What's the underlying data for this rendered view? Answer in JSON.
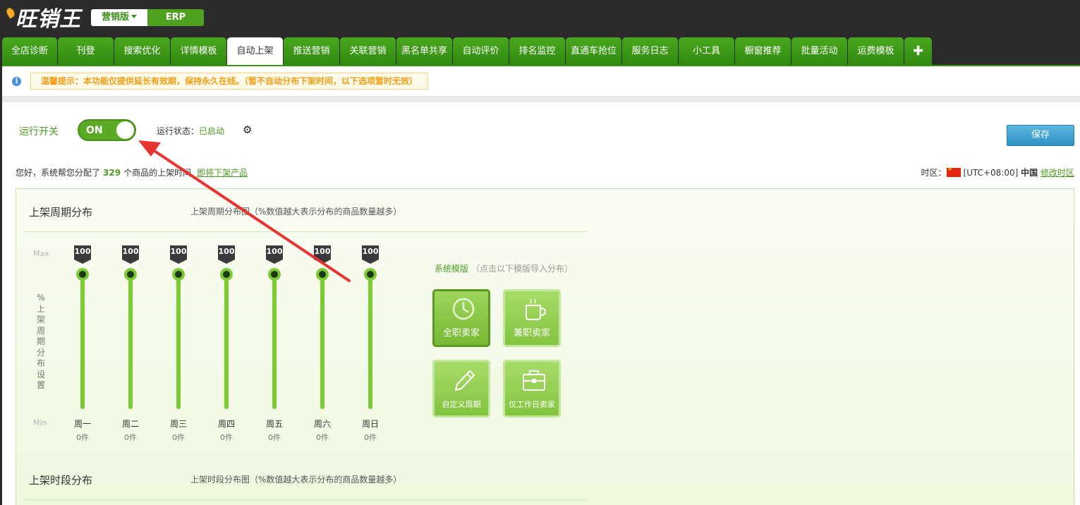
{
  "brand": {
    "logo_text": "旺销王"
  },
  "edition": {
    "active_label": "营销版",
    "erp_label": "ERP"
  },
  "tabs": [
    {
      "label": "全店诊断",
      "w": 78
    },
    {
      "label": "刊登",
      "w": 79
    },
    {
      "label": "搜索优化",
      "w": 79
    },
    {
      "label": "详情模板",
      "w": 79
    },
    {
      "label": "自动上架",
      "w": 79,
      "active": true
    },
    {
      "label": "推送营销",
      "w": 79
    },
    {
      "label": "关联营销",
      "w": 79
    },
    {
      "label": "黑名单共享",
      "w": 79
    },
    {
      "label": "自动评价",
      "w": 79
    },
    {
      "label": "排名监控",
      "w": 79
    },
    {
      "label": "直通车抢位",
      "w": 79
    },
    {
      "label": "服务日志",
      "w": 79
    },
    {
      "label": "小工具",
      "w": 79
    },
    {
      "label": "橱窗推荐",
      "w": 79
    },
    {
      "label": "批量活动",
      "w": 79
    },
    {
      "label": "运费模板",
      "w": 79
    },
    {
      "label": "✚",
      "w": 39,
      "plus": true
    }
  ],
  "notice": {
    "icon": "info-icon",
    "text": "温馨提示：本功能仅提供延长有效期，保持永久在线。（暂不自动分布下架时间，以下选项暂时无效）"
  },
  "control": {
    "run_label": "运行开关",
    "toggle_text": "ON",
    "status_label": "运行状态：",
    "status_value": "已启动",
    "save_label": "保存"
  },
  "summary": {
    "prefix": "您好，系统帮您分配了",
    "count": "329",
    "suffix": "个商品的上架时间",
    "link": "即将下架产品"
  },
  "timezone": {
    "label": "时区：",
    "utc": "[UTC+08:00]",
    "country": "中国",
    "link": "修改时区"
  },
  "week_section": {
    "title": "上架周期分布",
    "subtitle": "上架周期分布图（%数值越大表示分布的商品数量越多）",
    "y_max": "Max",
    "y_min": "Min",
    "y_title": "%上架周期分布设置",
    "days": [
      {
        "name": "周一",
        "value": "100",
        "count": "0件"
      },
      {
        "name": "周二",
        "value": "100",
        "count": "0件"
      },
      {
        "name": "周三",
        "value": "100",
        "count": "0件"
      },
      {
        "name": "周四",
        "value": "100",
        "count": "0件"
      },
      {
        "name": "周五",
        "value": "100",
        "count": "0件"
      },
      {
        "name": "周六",
        "value": "100",
        "count": "0件"
      },
      {
        "name": "周日",
        "value": "100",
        "count": "0件"
      }
    ]
  },
  "templates": {
    "title": "系统模版",
    "hint": "（点击以下模版导入分布）",
    "items": [
      {
        "label": "全职卖家",
        "icon": "clock-icon",
        "selected": true
      },
      {
        "label": "兼职卖家",
        "icon": "coffee-cup-icon"
      },
      {
        "label": "自定义周期",
        "icon": "pencil-icon"
      },
      {
        "label": "仅工作日卖家",
        "icon": "briefcase-icon"
      }
    ]
  },
  "time_section": {
    "title": "上架时段分布",
    "subtitle": "上架时段分布图（%数值越大表示分布的商品数量越多）"
  },
  "colors": {
    "brand_green": "#4c9b23",
    "annotation_arrow": "#e8322e",
    "save_blue": "#2e93c5"
  }
}
